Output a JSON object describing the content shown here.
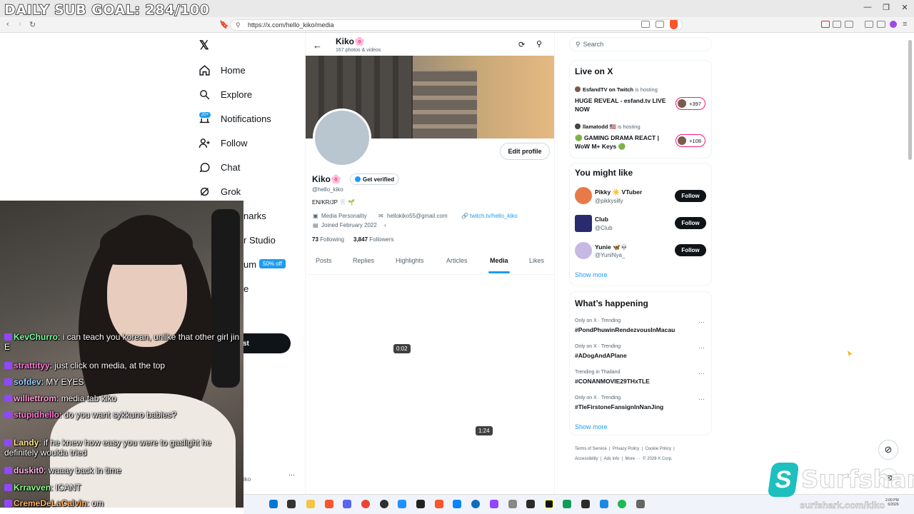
{
  "overlay": {
    "sub_goal": "DAILY SUB GOAL: 284/100"
  },
  "browser": {
    "url": "https://x.com/hello_kiko/media"
  },
  "nav": {
    "items": [
      {
        "label": "Home",
        "icon": "home-icon"
      },
      {
        "label": "Explore",
        "icon": "search-icon"
      },
      {
        "label": "Notifications",
        "icon": "bell-icon"
      },
      {
        "label": "Follow",
        "icon": "person-add-icon"
      },
      {
        "label": "Chat",
        "icon": "chat-icon"
      },
      {
        "label": "Grok",
        "icon": "grok-icon"
      }
    ],
    "notif_badge": "20+",
    "partial_items": [
      "narks",
      "r Studio",
      "um",
      "e"
    ],
    "premium_badge": "50% off",
    "post_button": "st",
    "account_partial": "iko",
    "more_dots": "···"
  },
  "profile": {
    "header_name": "Kiko🌸",
    "header_count": "167 photos & videos",
    "name": "Kiko🌸",
    "get_verified": "Get verified",
    "handle": "@hello_kiko",
    "bio": "EN/KR/JP 🦷 🌱",
    "category": "Media Personality",
    "email": "hellokiko55@gmail.com",
    "link": "twitch.tv/hello_kiko",
    "joined": "Joined February 2022",
    "following_count": "73",
    "following_label": "Following",
    "followers_count": "3,847",
    "followers_label": "Followers",
    "edit_button": "Edit profile",
    "tabs": [
      "Posts",
      "Replies",
      "Highlights",
      "Articles",
      "Media",
      "Likes"
    ],
    "active_tab": "Media",
    "video_times": [
      "0:02",
      "1:24"
    ]
  },
  "sidebar": {
    "search_placeholder": "Search",
    "live_title": "Live on X",
    "live": [
      {
        "user": "EsfandTV on Twitch",
        "hosting": "is hosting",
        "title": "HUGE REVEAL - esfand.tv LIVE NOW",
        "count": "+397"
      },
      {
        "user": "llamatodd 🇺🇸",
        "hosting": "is hosting",
        "title": "🟢 GAMING DRAMA REACT | WoW M+ Keys 🟢",
        "count": "+108"
      }
    ],
    "suggest_title": "You might like",
    "suggestions": [
      {
        "name": "Pikky ☀️ VTuber",
        "handle": "@pikkysilly",
        "button": "Follow",
        "color": "#e87a4a"
      },
      {
        "name": "Club",
        "handle": "@Club",
        "button": "Follow",
        "color": "#2a2a6e"
      },
      {
        "name": "Yunie 🦋💀",
        "handle": "@YuniNya_",
        "button": "Follow",
        "color": "#c7b9e4"
      }
    ],
    "show_more": "Show more",
    "happening_title": "What’s happening",
    "trends": [
      {
        "context": "Only on X · Trending",
        "name": "#PondPhuwinRendezvousInMacau"
      },
      {
        "context": "Only on X · Trending",
        "name": "#ADogAndAPlane"
      },
      {
        "context": "Trending in Thailand",
        "name": "#CONANMOVIE29THxTLE"
      },
      {
        "context": "Only on X · Trending",
        "name": "#TleFirstoneFansignInNanJing"
      }
    ],
    "show_more_2": "Show more",
    "footer_line1": "Terms of Service  |  Privacy Policy  |  Cookie Policy  |",
    "footer_line2": "Accessibility  |  Ads info  |  More ···  © 2026 X Corp."
  },
  "stream_chat": [
    {
      "user": "KevChurro",
      "color": "#7cfc9a",
      "msg": "i can teach you korean, unlike that other girl jin E"
    },
    {
      "user": "strattityy",
      "color": "#ff7ad9",
      "msg": "just click on media, at the top"
    },
    {
      "user": "sofdev",
      "color": "#9ad0ff",
      "msg": "MY EYES"
    },
    {
      "user": "williettrom",
      "color": "#ff9ad5",
      "msg": "media tab kiko"
    },
    {
      "user": "stupidhello",
      "color": "#ff7ad9",
      "msg": "do you want sykkuno babies?"
    },
    {
      "user": "Landy",
      "color": "#ffe680",
      "msg": "if he knew how easy you were to gaslight he definitely woulda tried"
    },
    {
      "user": "duskit0",
      "color": "#ffb3e6",
      "msg": "waaay back in time"
    },
    {
      "user": "Krravven",
      "color": "#8cff8c",
      "msg": "ICANT"
    },
    {
      "user": "CremeDeLaCalvin",
      "color": "#ffb366",
      "msg": "om"
    }
  ],
  "sponsor": {
    "name": "Surfshark",
    "url": "surfshark.com/kiko"
  },
  "system": {
    "time": "2:00 PM",
    "date": "6/2026"
  }
}
